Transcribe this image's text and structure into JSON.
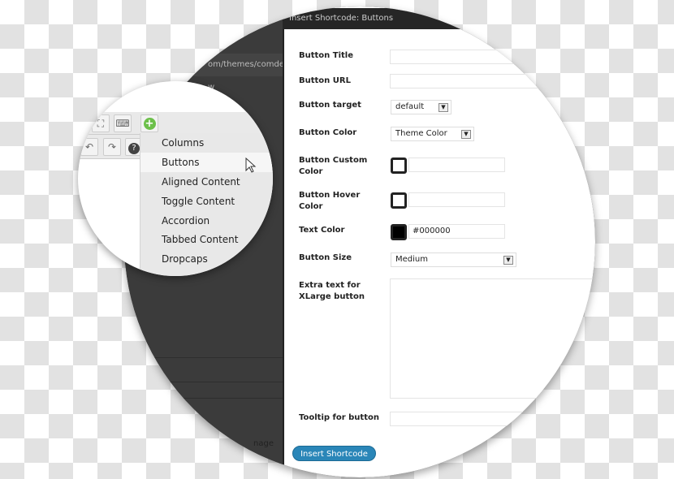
{
  "editor": {
    "url_fragment": "om/themes/comdex-w",
    "footer_fragment": "nage"
  },
  "dialog": {
    "title": "Insert Shortcode: Buttons",
    "fields": [
      {
        "label": "Button Title",
        "value": ""
      },
      {
        "label": "Button URL",
        "value": ""
      },
      {
        "label": "Button target",
        "value": "default"
      },
      {
        "label": "Button Color",
        "value": "Theme Color"
      },
      {
        "label": "Button Custom Color",
        "value": ""
      },
      {
        "label": "Button Hover Color",
        "value": ""
      },
      {
        "label": "Text Color",
        "value": "#000000"
      },
      {
        "label": "Button Size",
        "value": "Medium"
      },
      {
        "label": "Extra text for XLarge button",
        "value": ""
      },
      {
        "label": "Tooltip for button",
        "value": ""
      }
    ],
    "submit_label": "Insert Shortcode"
  },
  "shortcode_menu": {
    "items": [
      "Columns",
      "Buttons",
      "Aligned Content",
      "Toggle Content",
      "Accordion",
      "Tabbed Content",
      "Dropcaps"
    ],
    "hovered": "Buttons"
  },
  "colors": {
    "accent": "#2a86b8",
    "title_bar": "#262626",
    "overlay": "#3b3b3b",
    "add_icon": "#6cc04a"
  }
}
